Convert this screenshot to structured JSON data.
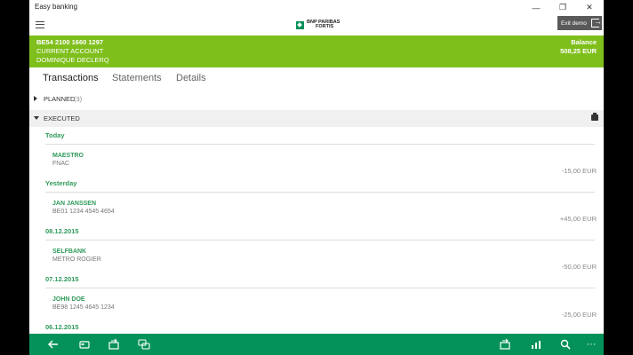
{
  "window": {
    "title": "Easy banking",
    "controls": {
      "minimize": "—",
      "maximize": "❐",
      "close": "✕"
    }
  },
  "header": {
    "logo_line1": "BNP PARIBAS",
    "logo_line2": "FORTIS",
    "exit_demo_label": "Exit demo"
  },
  "account": {
    "iban": "BE54 2100 1660 1297",
    "type": "CURRENT ACCOUNT",
    "holder": "DOMINIQUE DECLERQ",
    "balance_label": "Balance",
    "balance_value": "508,25 EUR"
  },
  "tabs": [
    {
      "label": "Transactions",
      "active": true
    },
    {
      "label": "Statements",
      "active": false
    },
    {
      "label": "Details",
      "active": false
    }
  ],
  "planned": {
    "label": "PLANNED",
    "count": "(3)"
  },
  "executed": {
    "label": "EXECUTED"
  },
  "groups": [
    {
      "date": "Today",
      "tx": {
        "name": "MAESTRO",
        "desc": "FNAC",
        "amount": "-15,00 EUR"
      }
    },
    {
      "date": "Yesterday",
      "tx": {
        "name": "JAN JANSSEN",
        "desc": "BE01 1234 4545 4654",
        "amount": "+45,00 EUR"
      }
    },
    {
      "date": "08.12.2015",
      "tx": {
        "name": "SELFBANK",
        "desc": "METRO ROGIER",
        "amount": "-50,00 EUR"
      }
    },
    {
      "date": "07.12.2015",
      "tx": {
        "name": "JOHN DOE",
        "desc": "BE98 1245 4645 1234",
        "amount": "-25,00 EUR"
      }
    },
    {
      "date": "06.12.2015"
    }
  ],
  "bottombar": {
    "icons": [
      "back-icon",
      "card-icon",
      "transfer-icon",
      "chat-icon",
      "transfer-alt-icon",
      "stats-icon",
      "search-icon",
      "more-icon"
    ],
    "more_label": "···"
  }
}
